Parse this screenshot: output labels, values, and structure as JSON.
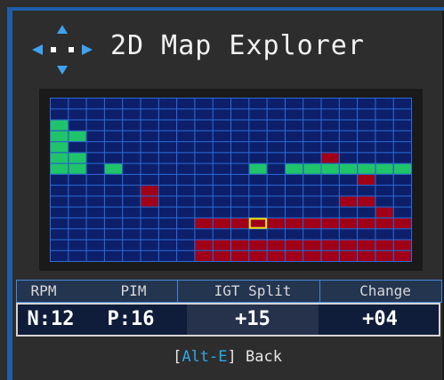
{
  "header": {
    "title": "2D Map Explorer",
    "dpad_icon": "dpad-arrows-icon"
  },
  "grid": {
    "cols": 20,
    "rows": 15,
    "colors": {
      "line": "#2d6cd6",
      "cell": "#0d1f6a",
      "green": "#1fc46a",
      "red": "#a00018",
      "cursor": "#f0e000"
    },
    "green_cells": [
      [
        2,
        0
      ],
      [
        3,
        0
      ],
      [
        3,
        1
      ],
      [
        4,
        0
      ],
      [
        5,
        0
      ],
      [
        5,
        1
      ],
      [
        6,
        0
      ],
      [
        6,
        1
      ],
      [
        6,
        3
      ],
      [
        6,
        11
      ],
      [
        6,
        13
      ],
      [
        6,
        14
      ],
      [
        6,
        15
      ],
      [
        6,
        16
      ],
      [
        6,
        17
      ],
      [
        6,
        18
      ],
      [
        6,
        19
      ]
    ],
    "red_cells": [
      [
        5,
        15
      ],
      [
        7,
        17
      ],
      [
        8,
        5
      ],
      [
        9,
        5
      ],
      [
        9,
        16
      ],
      [
        9,
        17
      ],
      [
        10,
        18
      ],
      [
        11,
        8
      ],
      [
        11,
        9
      ],
      [
        11,
        10
      ],
      [
        11,
        11
      ],
      [
        11,
        12
      ],
      [
        11,
        13
      ],
      [
        11,
        14
      ],
      [
        11,
        15
      ],
      [
        11,
        16
      ],
      [
        11,
        17
      ],
      [
        11,
        18
      ],
      [
        11,
        19
      ],
      [
        13,
        8
      ],
      [
        13,
        9
      ],
      [
        13,
        10
      ],
      [
        13,
        11
      ],
      [
        13,
        12
      ],
      [
        13,
        13
      ],
      [
        13,
        14
      ],
      [
        13,
        15
      ],
      [
        13,
        16
      ],
      [
        13,
        17
      ],
      [
        13,
        18
      ],
      [
        13,
        19
      ],
      [
        14,
        8
      ],
      [
        14,
        9
      ],
      [
        14,
        10
      ],
      [
        14,
        11
      ],
      [
        14,
        12
      ],
      [
        14,
        13
      ],
      [
        14,
        14
      ],
      [
        14,
        15
      ],
      [
        14,
        16
      ],
      [
        14,
        17
      ],
      [
        14,
        18
      ],
      [
        14,
        19
      ]
    ],
    "cursor_cell": [
      11,
      11
    ]
  },
  "info": {
    "headers": [
      "RPM",
      "PIM",
      "IGT Split",
      "Change"
    ],
    "values": [
      "N:12",
      "P:16",
      "+15",
      "+04"
    ]
  },
  "footer": {
    "key_open": "[",
    "key": "Alt-E",
    "key_close": "]",
    "action": " Back"
  }
}
